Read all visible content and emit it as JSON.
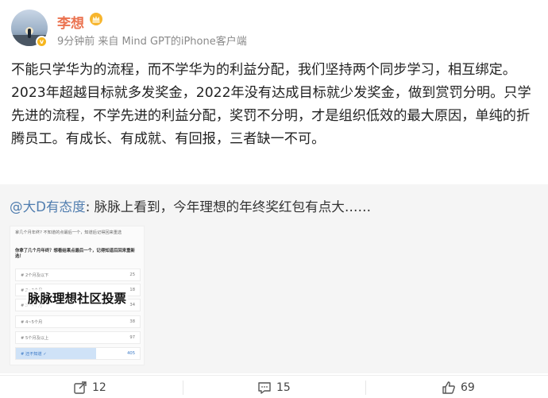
{
  "user": {
    "name": "李想",
    "meta": "9分钟前 来自 Mind GPT的iPhone客户端"
  },
  "post": {
    "text": "不能只学华为的流程，而不学华为的利益分配，我们坚持两个同步学习，相互绑定。2023年超越目标就多发奖金，2022年没有达成目标就少发奖金，做到赏罚分明。只学先进的流程，不学先进的利益分配，奖罚不分明，才是组织低效的最大原因，单纯的折腾员工。有成长、有成就、有回报，三者缺一不可。"
  },
  "repost": {
    "mention": "@大D有态度",
    "text": ": 脉脉上看到，今年理想的年终奖红包有点大……",
    "image": {
      "question_small": "拿几个月年终? 不知道的点最后一个，知道后记得回来重选",
      "question": "你拿了几个月年终？想看结果点最后一个，记得知道后回来重新选！",
      "overlay": "脉脉理想社区投票",
      "options": [
        {
          "label": "# 2个月及以下",
          "count": "25",
          "selected": false
        },
        {
          "label": "# 2~3个月",
          "count": "18",
          "selected": false
        },
        {
          "label": "# 3~4个月",
          "count": "34",
          "selected": false
        },
        {
          "label": "# 4~5个月",
          "count": "38",
          "selected": false
        },
        {
          "label": "# 5个月及以上",
          "count": "97",
          "selected": false
        },
        {
          "label": "# 还不知道 ✓",
          "count": "405",
          "selected": true,
          "fill_fraction": 0.65
        }
      ]
    }
  },
  "actions": {
    "repost_count": "12",
    "comment_count": "15",
    "like_count": "69",
    "icons": [
      "share-icon",
      "comment-icon",
      "like-icon"
    ]
  },
  "colors": {
    "name": "#eb7350",
    "mention": "#507daf",
    "repost_bg": "#f5f5f5",
    "vote_fill": "#cfe2f7"
  }
}
